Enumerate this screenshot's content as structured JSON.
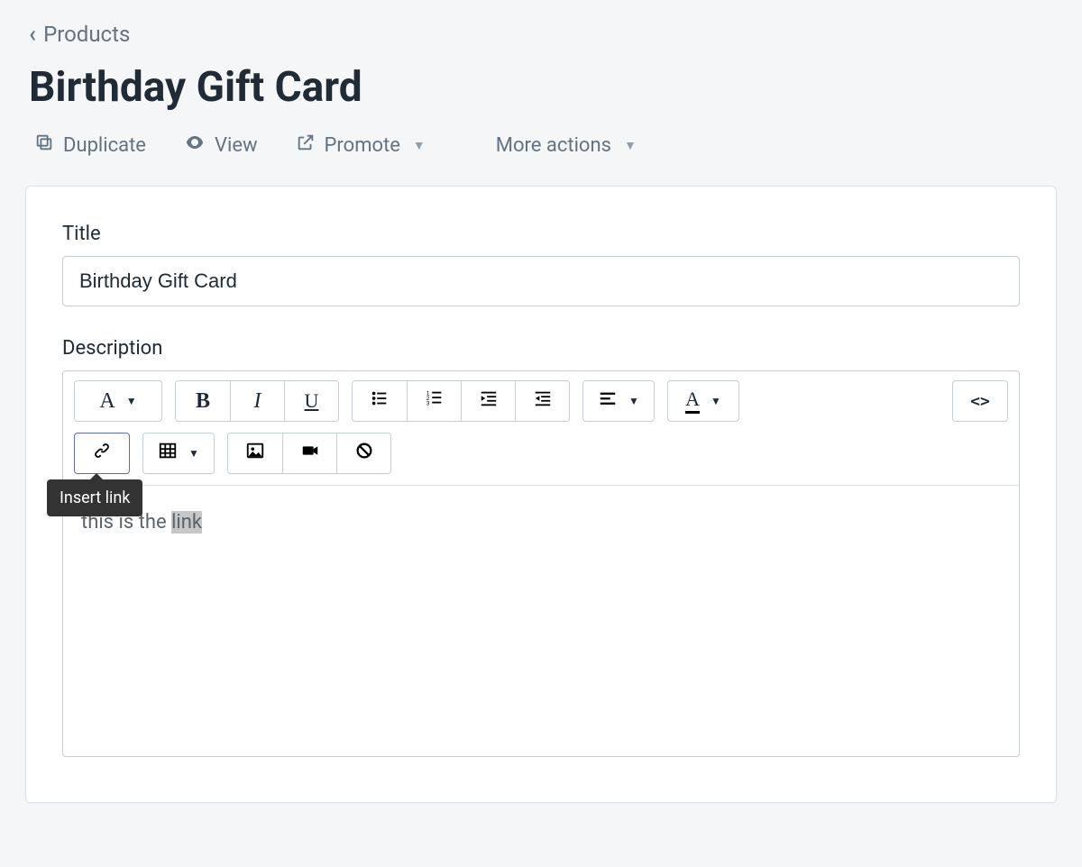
{
  "breadcrumb": {
    "back_label": "Products"
  },
  "page": {
    "title": "Birthday Gift Card"
  },
  "actions": {
    "duplicate": "Duplicate",
    "view": "View",
    "promote": "Promote",
    "more": "More actions"
  },
  "form": {
    "title_label": "Title",
    "title_value": "Birthday Gift Card",
    "description_label": "Description",
    "body_prefix": "this is the ",
    "body_selected": "link"
  },
  "toolbar": {
    "tooltip_insert_link": "Insert link"
  }
}
